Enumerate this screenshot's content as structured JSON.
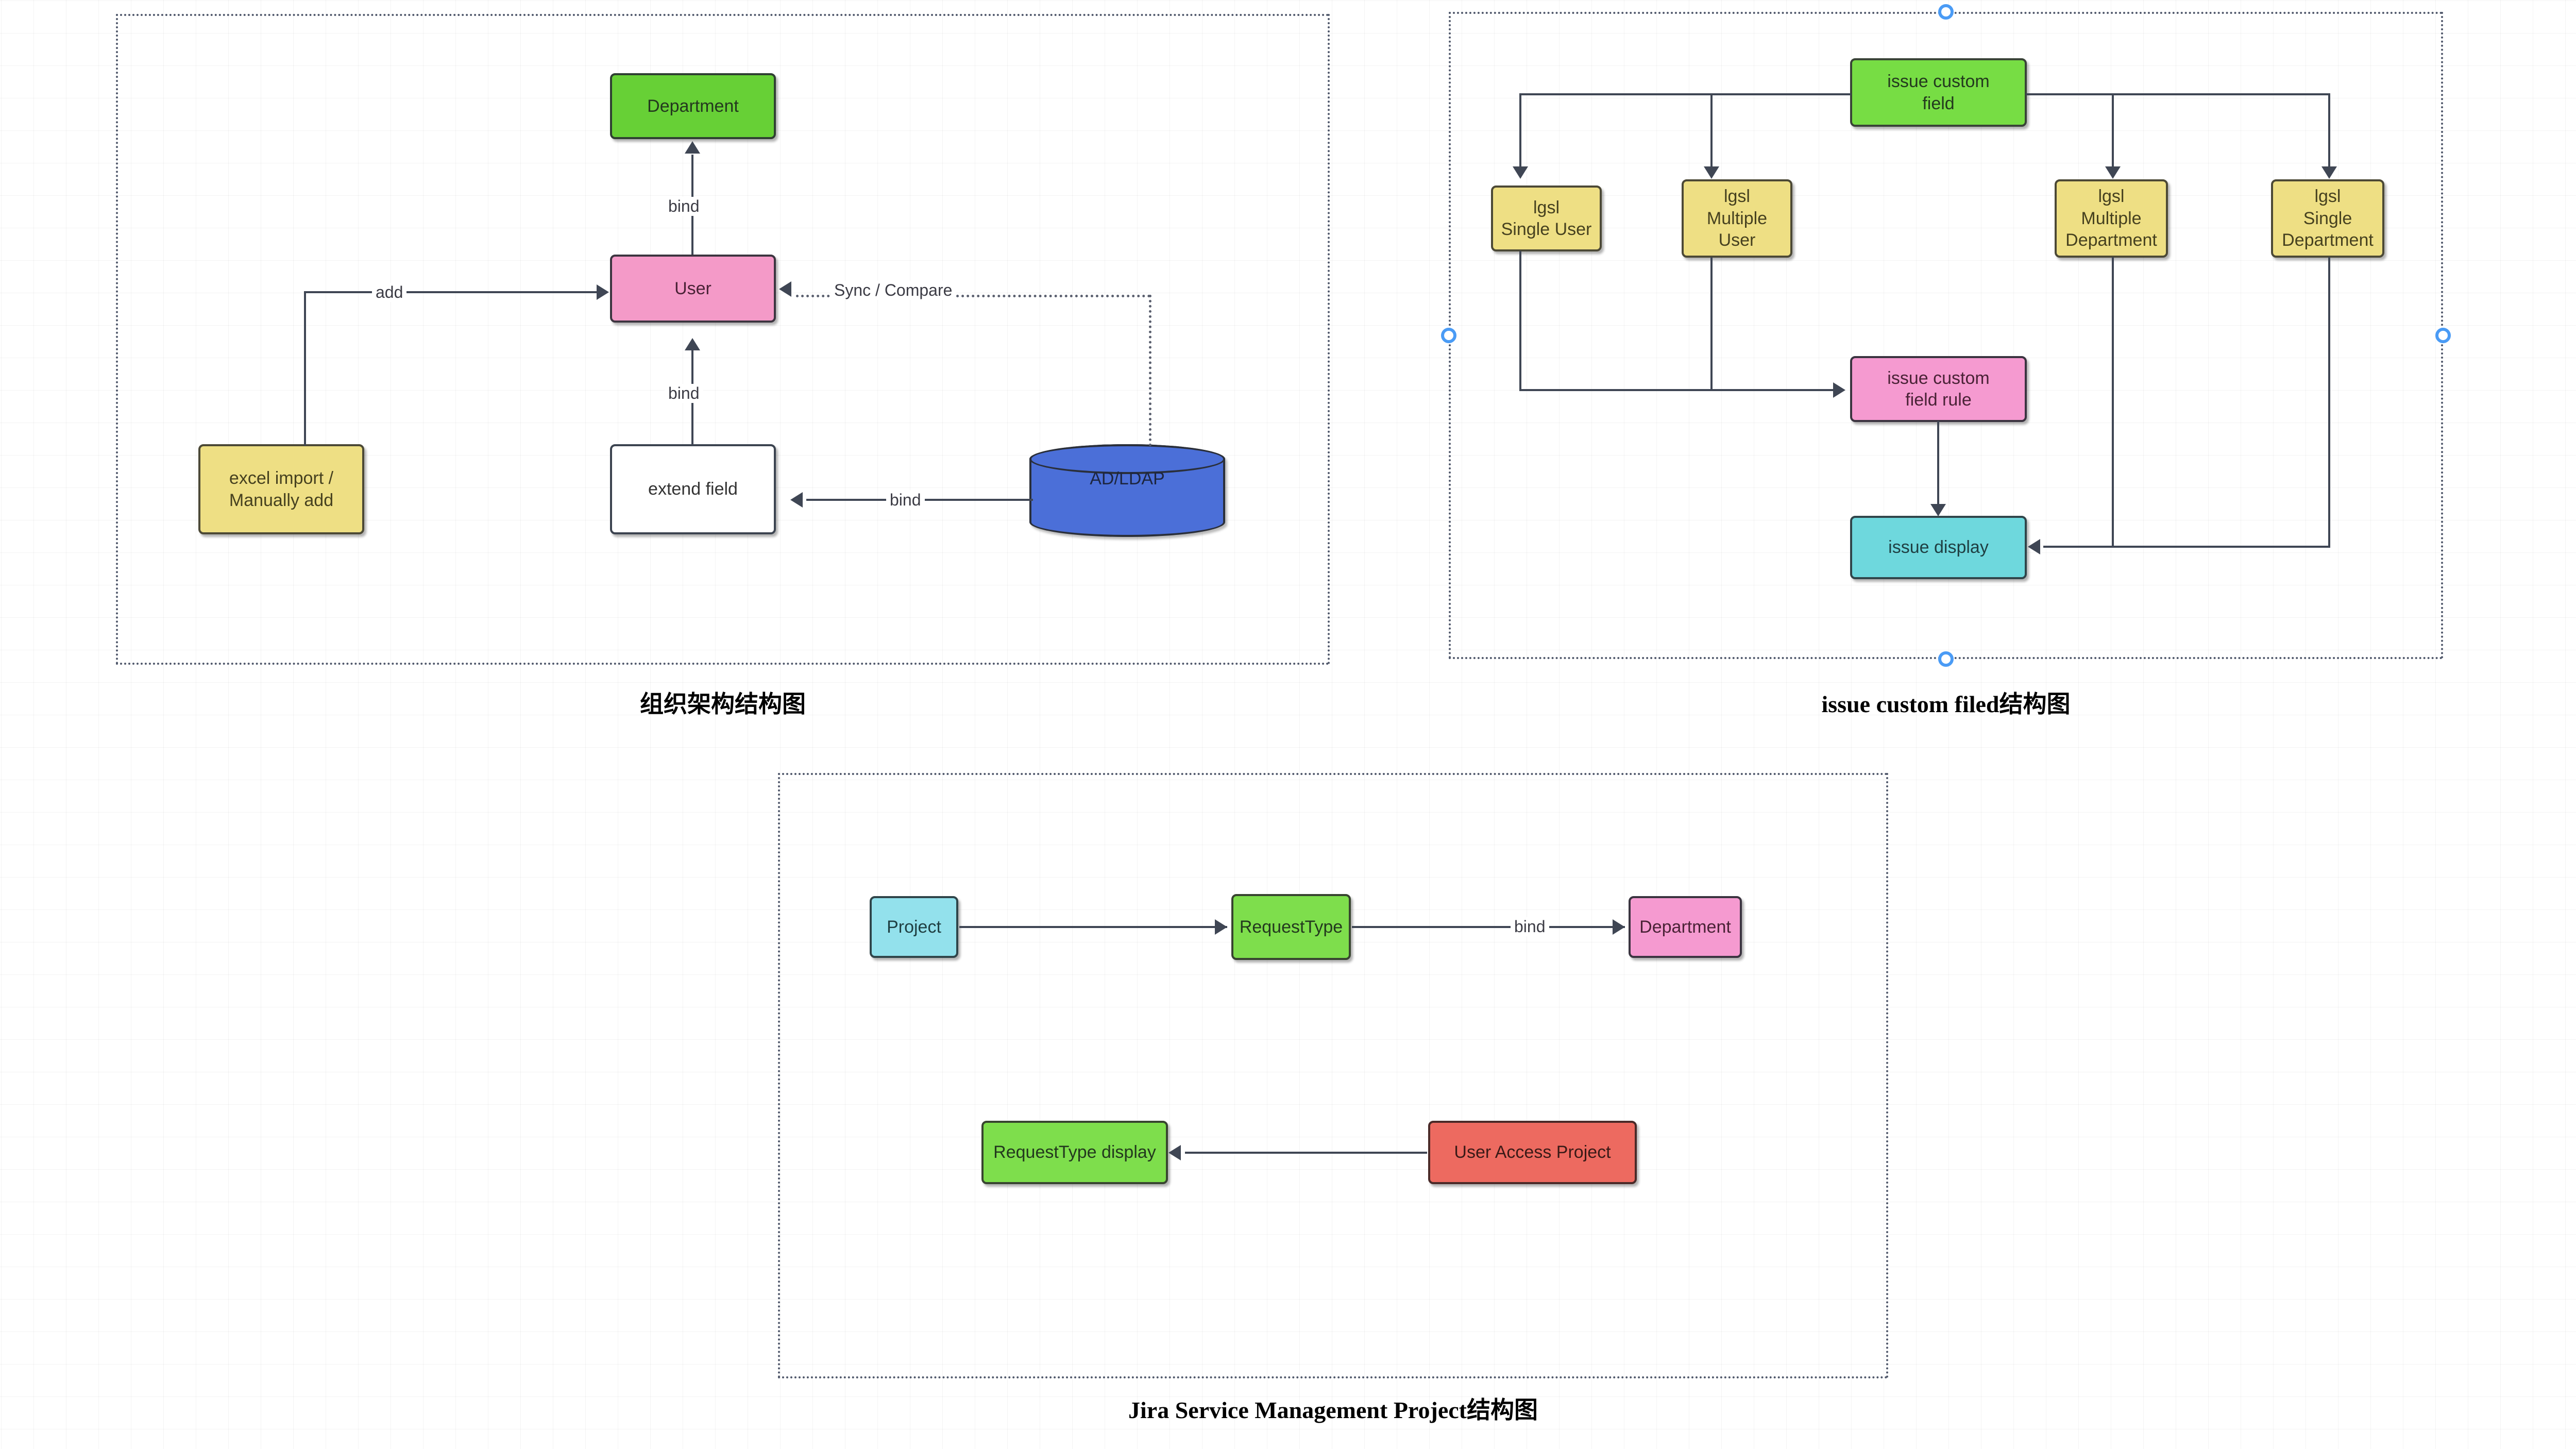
{
  "panels": [
    {
      "id": "org-structure",
      "caption": "组织架构结构图",
      "nodes": [
        {
          "key": "department",
          "label": "Department",
          "color": "#67d036"
        },
        {
          "key": "user",
          "label": "User",
          "color": "#f49ac8"
        },
        {
          "key": "excel_import",
          "label": "excel import /\nManually add",
          "color": "#eedf84"
        },
        {
          "key": "extend_field",
          "label": "extend field",
          "color": "#ffffff"
        },
        {
          "key": "ad_ldap",
          "label": "AD/LDAP",
          "color": "#4b6fd8"
        }
      ],
      "edges": [
        {
          "from": "user",
          "to": "department",
          "label": "bind"
        },
        {
          "from": "excel_import",
          "to": "user",
          "label": "add"
        },
        {
          "from": "extend_field",
          "to": "user",
          "label": "bind"
        },
        {
          "from": "ad_ldap",
          "to": "extend_field",
          "label": "bind"
        },
        {
          "from": "ad_ldap",
          "to": "user",
          "label": "Sync / Compare",
          "style": "dotted"
        }
      ]
    },
    {
      "id": "issue-custom-field",
      "caption": "issue custom filed结构图",
      "nodes": [
        {
          "key": "issue_custom_field",
          "label": "issue custom\nfield",
          "color": "#77dd44"
        },
        {
          "key": "igsl_single_user",
          "label": "lgsl\nSingle User",
          "color": "#eedf84"
        },
        {
          "key": "igsl_multiple_user",
          "label": "lgsl\nMultiple\nUser",
          "color": "#eedf84"
        },
        {
          "key": "igsl_multiple_department",
          "label": "lgsl\nMultiple\nDepartment",
          "color": "#eedf84"
        },
        {
          "key": "igsl_single_department",
          "label": "lgsl\nSingle\nDepartment",
          "color": "#eedf84"
        },
        {
          "key": "issue_custom_field_rule",
          "label": "issue custom\nfield rule",
          "color": "#f59ad0"
        },
        {
          "key": "issue_display",
          "label": "issue display",
          "color": "#6ed8dd"
        }
      ],
      "edges": [
        {
          "from": "issue_custom_field",
          "to": "igsl_single_user",
          "label": ""
        },
        {
          "from": "issue_custom_field",
          "to": "igsl_multiple_user",
          "label": ""
        },
        {
          "from": "issue_custom_field",
          "to": "igsl_multiple_department",
          "label": ""
        },
        {
          "from": "issue_custom_field",
          "to": "igsl_single_department",
          "label": ""
        },
        {
          "from": "igsl_single_user",
          "to": "issue_custom_field_rule",
          "label": ""
        },
        {
          "from": "igsl_multiple_user",
          "to": "issue_custom_field_rule",
          "label": ""
        },
        {
          "from": "issue_custom_field_rule",
          "to": "issue_display",
          "label": ""
        },
        {
          "from": "igsl_multiple_department",
          "to": "issue_display",
          "label": ""
        },
        {
          "from": "igsl_single_department",
          "to": "issue_display",
          "label": ""
        }
      ],
      "handles": 4
    },
    {
      "id": "jira-service-management-project",
      "caption": "Jira Service Management Project结构图",
      "nodes": [
        {
          "key": "project",
          "label": "Project",
          "color": "#93e1ec"
        },
        {
          "key": "request_type",
          "label": "RequestType",
          "color": "#7ede4c"
        },
        {
          "key": "department2",
          "label": "Department",
          "color": "#f59ad0"
        },
        {
          "key": "request_type_display",
          "label": "RequestType display",
          "color": "#7ede4c"
        },
        {
          "key": "user_access_project",
          "label": "User  Access Project",
          "color": "#ed6a60"
        }
      ],
      "edges": [
        {
          "from": "project",
          "to": "request_type",
          "label": ""
        },
        {
          "from": "request_type",
          "to": "department2",
          "label": "bind"
        },
        {
          "from": "user_access_project",
          "to": "request_type_display",
          "label": ""
        }
      ]
    }
  ],
  "colors": {
    "edge": "#3f4654",
    "frame": "#50586b",
    "handle": "#4a9bf5",
    "grid": "#f0f0f0"
  },
  "chart_data": {
    "type": "table",
    "title": "Structure diagrams"
  }
}
